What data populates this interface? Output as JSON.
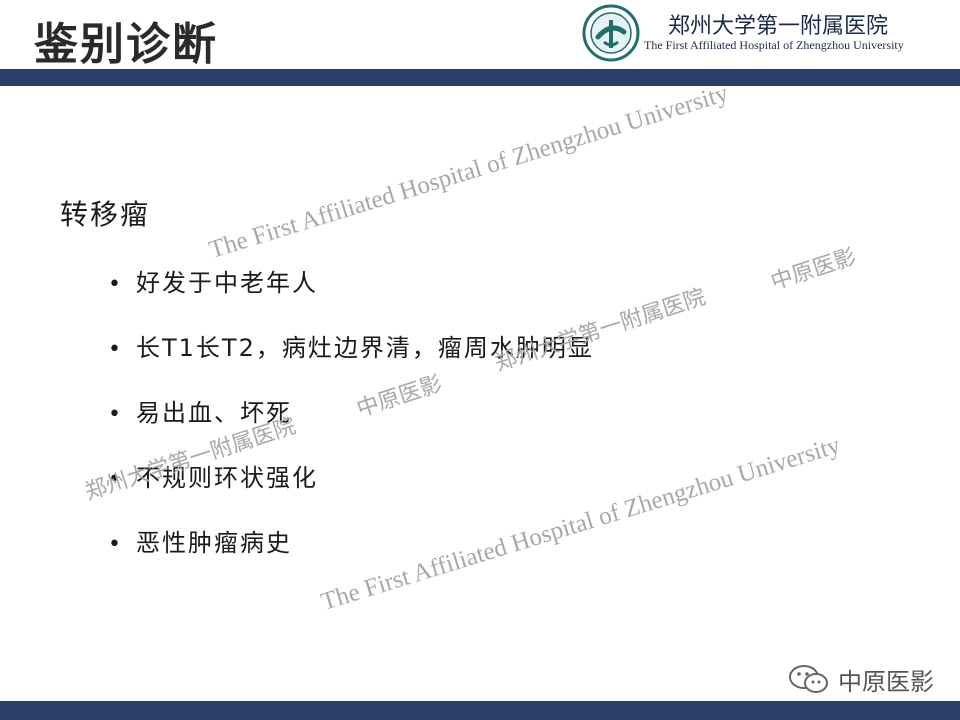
{
  "title": "鉴别诊断",
  "hospital": {
    "name_cn": "郑州大学第一附属医院",
    "name_en": "The First Affiliated Hospital of Zhengzhou University"
  },
  "content": {
    "heading": "转移瘤",
    "bullet_symbol": "•",
    "items": [
      "好发于中老年人",
      "长T1长T2，病灶边界清，瘤周水肿明显",
      "易出血、坏死",
      "不规则环状强化",
      "恶性肿瘤病史"
    ]
  },
  "watermarks": {
    "english": "The First Affiliated Hospital of Zhengzhou University",
    "hospital_cn": "郑州大学第一附属医院",
    "brand_cn": "中原医影"
  },
  "brand": {
    "label": "中原医影",
    "icon": "wechat-icon"
  },
  "colors": {
    "bar": "#2b3e68",
    "watermark": "#a8a8a8",
    "logo": "#1f6e70"
  }
}
